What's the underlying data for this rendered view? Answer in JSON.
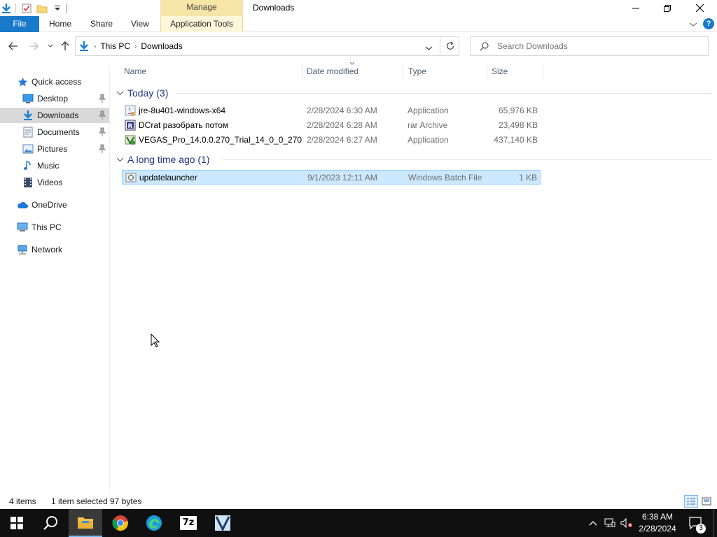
{
  "window": {
    "title": "Downloads",
    "manage_label": "Manage"
  },
  "ribbon": {
    "file": "File",
    "home": "Home",
    "share": "Share",
    "view": "View",
    "app_tools": "Application Tools"
  },
  "address": {
    "crumbs": [
      "This PC",
      "Downloads"
    ]
  },
  "search": {
    "placeholder": "Search Downloads"
  },
  "sidebar": {
    "items": [
      {
        "label": "Quick access",
        "icon": "star-icon"
      },
      {
        "label": "Desktop",
        "icon": "desktop-icon",
        "pinned": true
      },
      {
        "label": "Downloads",
        "icon": "download-icon",
        "pinned": true,
        "selected": true
      },
      {
        "label": "Documents",
        "icon": "documents-icon",
        "pinned": true
      },
      {
        "label": "Pictures",
        "icon": "pictures-icon",
        "pinned": true
      },
      {
        "label": "Music",
        "icon": "music-icon"
      },
      {
        "label": "Videos",
        "icon": "videos-icon"
      },
      {
        "label": "OneDrive",
        "icon": "cloud-icon"
      },
      {
        "label": "This PC",
        "icon": "computer-icon"
      },
      {
        "label": "Network",
        "icon": "network-icon"
      }
    ]
  },
  "columns": {
    "name": "Name",
    "date": "Date modified",
    "type": "Type",
    "size": "Size"
  },
  "groups": [
    {
      "label": "Today (3)",
      "files": [
        {
          "name": "jre-8u401-windows-x64",
          "date": "2/28/2024 6:30 AM",
          "type": "Application",
          "size": "65,976 KB",
          "icon": "java-installer-icon"
        },
        {
          "name": "DCrat разобрать потом",
          "date": "2/28/2024 6:28 AM",
          "type": "rar Archive",
          "size": "23,498 KB",
          "icon": "rar-archive-icon"
        },
        {
          "name": "VEGAS_Pro_14.0.0.270_Trial_14_0_0_270",
          "date": "2/28/2024 6:27 AM",
          "type": "Application",
          "size": "437,140 KB",
          "icon": "vegas-installer-icon"
        }
      ]
    },
    {
      "label": "A long time ago (1)",
      "files": [
        {
          "name": "updatelauncher",
          "date": "9/1/2023 12:11 AM",
          "type": "Windows Batch File",
          "size": "1 KB",
          "icon": "batch-file-icon",
          "selected": true
        }
      ]
    }
  ],
  "status": {
    "items": "4 items",
    "selected": "1 item selected",
    "bytes": "97 bytes"
  },
  "taskbar": {
    "time": "6:38 AM",
    "date": "2/28/2024",
    "notifications": "3"
  },
  "colors": {
    "accent": "#1979ca",
    "selection": "#cce8ff",
    "group_header": "#1e3287",
    "manage_tab": "#f5e6a8"
  }
}
